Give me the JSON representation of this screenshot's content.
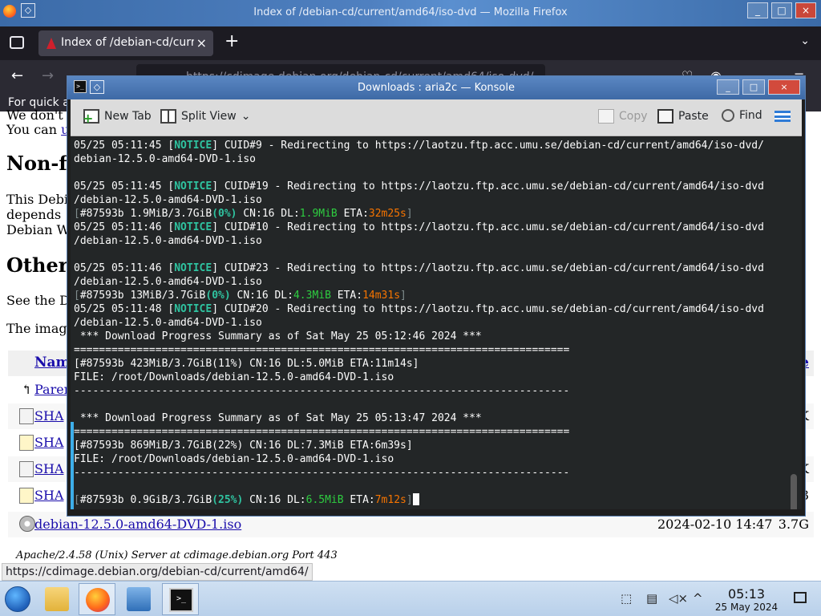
{
  "firefox": {
    "window_title": "Index of /debian-cd/current/amd64/iso-dvd — Mozilla Firefox",
    "tab_label": "Index of /debian-cd/current/amd64/iso-dvd",
    "tab_close": "×",
    "new_tab": "+",
    "url": "https://cdimage.debian.org/debian-cd/current/amd64/iso-dvd/",
    "notice": "For quick a",
    "status_url": "https://cdimage.debian.org/debian-cd/current/amd64/"
  },
  "page": {
    "partial_lines": [
      "We don't",
      "You can "
    ],
    "partial_link": "u",
    "h_nonfree": "Non-f",
    "nonfree_lines": [
      "This Debi",
      "depends ",
      "Debian W"
    ],
    "h_other": "Other",
    "see_text": "See the D",
    "image_text": "The image",
    "table_header_name": "Nam",
    "table_header_right": "e",
    "rows": [
      {
        "name": "Paren",
        "right": ""
      },
      {
        "name": "SHA",
        "right": "K"
      },
      {
        "name": "SHA",
        "right": ""
      },
      {
        "name": "SHA",
        "right": "K"
      },
      {
        "name": "SHA",
        "right": "3"
      }
    ],
    "iso_name": "debian-12.5.0-amd64-DVD-1.iso",
    "iso_date": "2024-02-10 14:47",
    "iso_size": "3.7G",
    "server_sig": "Apache/2.4.58 (Unix) Server at cdimage.debian.org Port 443"
  },
  "konsole": {
    "title": "Downloads : aria2c — Konsole",
    "toolbar": {
      "new_tab": "New Tab",
      "split_view": "Split View",
      "copy": "Copy",
      "paste": "Paste",
      "find": "Find"
    },
    "lines": {
      "l1a": "05/25 05:11:45 [",
      "l1b": "NOTICE",
      "l1c": "] CUID#9 - Redirecting to https://laotzu.ftp.acc.umu.se/debian-cd/current/amd64/iso-dvd/",
      "l2": "debian-12.5.0-amd64-DVD-1.iso",
      "l3a": "05/25 05:11:45 [",
      "l3b": "NOTICE",
      "l3c": "] CUID#19 - Redirecting to https://laotzu.ftp.acc.umu.se/debian-cd/current/amd64/iso-dvd",
      "l4": "/debian-12.5.0-amd64-DVD-1.iso",
      "p1a": "[",
      "p1b": "#87593b 1.9MiB/3.7GiB",
      "p1c": "(0%)",
      "p1d": " CN:16 DL:",
      "p1e": "1.9MiB",
      "p1f": " ETA:",
      "p1g": "32m25s",
      "p1h": "]",
      "l5a": "05/25 05:11:46 [",
      "l5b": "NOTICE",
      "l5c": "] CUID#10 - Redirecting to https://laotzu.ftp.acc.umu.se/debian-cd/current/amd64/iso-dvd",
      "l6": "/debian-12.5.0-amd64-DVD-1.iso",
      "l7a": "05/25 05:11:46 [",
      "l7b": "NOTICE",
      "l7c": "] CUID#23 - Redirecting to https://laotzu.ftp.acc.umu.se/debian-cd/current/amd64/iso-dvd",
      "l8": "/debian-12.5.0-amd64-DVD-1.iso",
      "p2a": "[",
      "p2b": "#87593b 13MiB/3.7GiB",
      "p2c": "(0%)",
      "p2d": " CN:16 DL:",
      "p2e": "4.3MiB",
      "p2f": " ETA:",
      "p2g": "14m31s",
      "p2h": "]",
      "l9a": "05/25 05:11:48 [",
      "l9b": "NOTICE",
      "l9c": "] CUID#20 - Redirecting to https://laotzu.ftp.acc.umu.se/debian-cd/current/amd64/iso-dvd",
      "l10": "/debian-12.5.0-amd64-DVD-1.iso",
      "s1": " *** Download Progress Summary as of Sat May 25 05:12:46 2024 ***",
      "eq1": "===============================================================================",
      "s1r": "[#87593b 423MiB/3.7GiB(11%) CN:16 DL:5.0MiB ETA:11m14s]",
      "s1f": "FILE: /root/Downloads/debian-12.5.0-amd64-DVD-1.iso",
      "dash1": "-------------------------------------------------------------------------------",
      "s2": " *** Download Progress Summary as of Sat May 25 05:13:47 2024 ***",
      "eq2": "===============================================================================",
      "s2r": "[#87593b 869MiB/3.7GiB(22%) CN:16 DL:7.3MiB ETA:6m39s]",
      "s2f": "FILE: /root/Downloads/debian-12.5.0-amd64-DVD-1.iso",
      "dash2": "-------------------------------------------------------------------------------",
      "p3a": "[",
      "p3b": "#87593b 0.9GiB/3.7GiB",
      "p3c": "(25%)",
      "p3d": " CN:16 DL:",
      "p3e": "6.5MiB",
      "p3f": " ETA:",
      "p3g": "7m12s",
      "p3h": "]"
    }
  },
  "taskbar": {
    "time": "05:13",
    "date": "25 May 2024",
    "konsole_glyph": ">_"
  },
  "colors": {
    "notice": "#2fc3a0",
    "dl_speed": "#2ecc40",
    "eta": "#f67400",
    "terminal_bg": "#232627"
  }
}
